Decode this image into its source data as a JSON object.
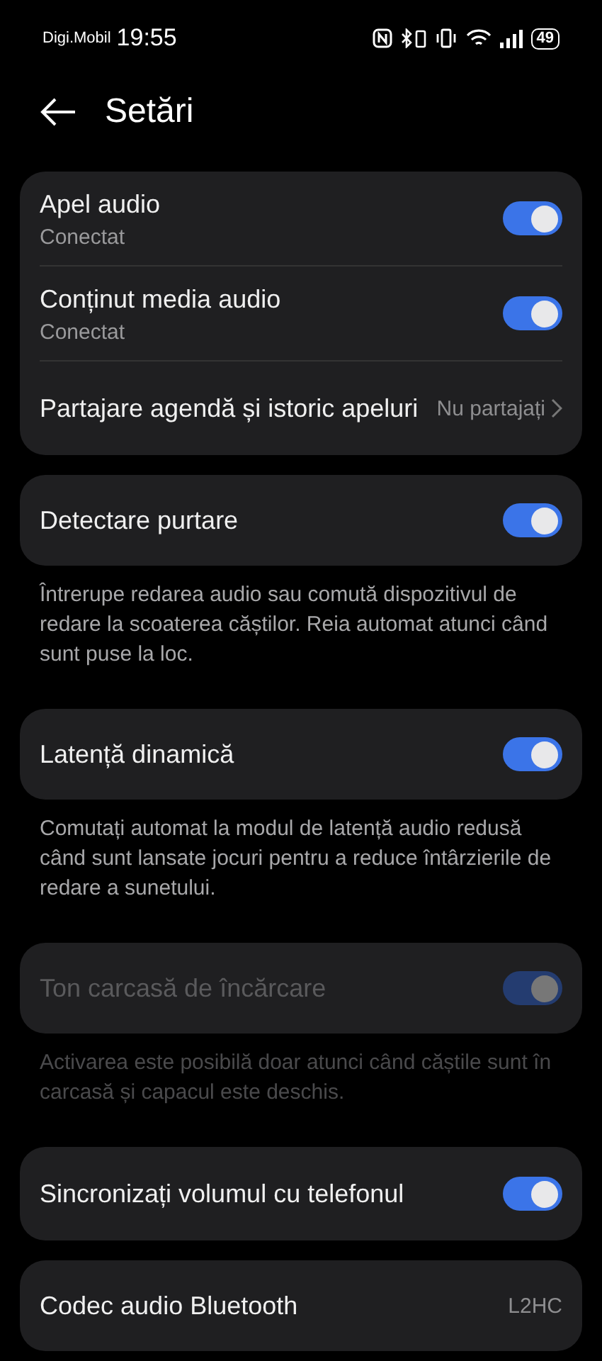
{
  "status_bar": {
    "carrier": "Digi.Mobil",
    "time": "19:55",
    "battery": "49"
  },
  "header": {
    "title": "Setări"
  },
  "groups": [
    {
      "disabled": false,
      "rows": [
        {
          "kind": "toggle",
          "title": "Apel audio",
          "subtitle": "Conectat",
          "on": true
        },
        {
          "kind": "toggle",
          "title": "Conținut media audio",
          "subtitle": "Conectat",
          "on": true
        },
        {
          "kind": "link",
          "title": "Partajare agendă și istoric apeluri",
          "value": "Nu partajați"
        }
      ]
    },
    {
      "disabled": false,
      "rows": [
        {
          "kind": "toggle",
          "title": "Detectare purtare",
          "on": true
        }
      ],
      "note": "Întrerupe redarea audio sau comută dispozitivul de redare la scoaterea căștilor. Reia automat atunci când sunt puse la loc."
    },
    {
      "disabled": false,
      "rows": [
        {
          "kind": "toggle",
          "title": "Latență dinamică",
          "on": true
        }
      ],
      "note": "Comutați automat la modul de latență audio redusă când sunt lansate jocuri pentru a reduce întârzierile de redare a sunetului."
    },
    {
      "disabled": true,
      "rows": [
        {
          "kind": "toggle",
          "title": "Ton carcasă de încărcare",
          "on": true
        }
      ],
      "note": "Activarea este posibilă doar atunci când căștile sunt în carcasă și capacul este deschis."
    },
    {
      "disabled": false,
      "rows": [
        {
          "kind": "toggle",
          "title": "Sincronizați volumul cu telefonul",
          "on": true
        }
      ]
    },
    {
      "disabled": false,
      "rows": [
        {
          "kind": "value",
          "title": "Codec audio Bluetooth",
          "value": "L2HC"
        }
      ]
    }
  ]
}
